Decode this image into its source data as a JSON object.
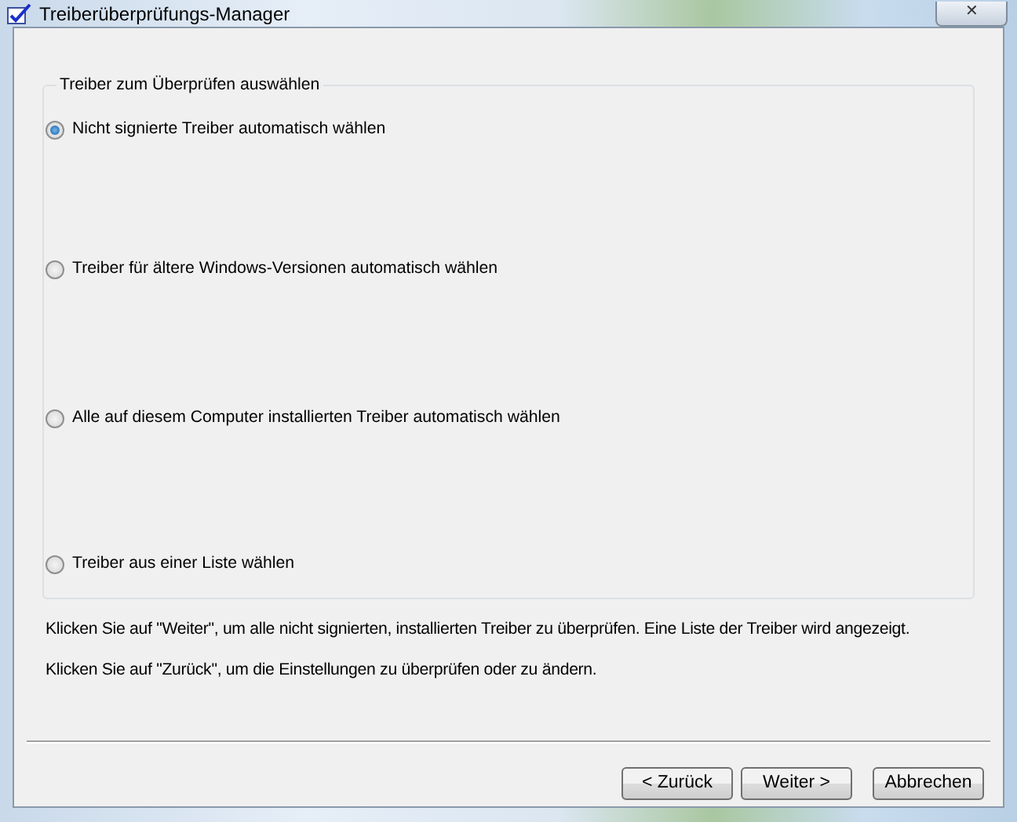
{
  "window": {
    "title": "Treiberüberprüfungs-Manager",
    "close": "✕"
  },
  "group": {
    "title": "Treiber zum Überprüfen auswählen",
    "options": [
      {
        "label": "Nicht signierte Treiber automatisch wählen",
        "selected": true
      },
      {
        "label": "Treiber für ältere Windows-Versionen automatisch wählen",
        "selected": false
      },
      {
        "label": "Alle auf diesem Computer installierten Treiber automatisch wählen",
        "selected": false
      },
      {
        "label": "Treiber aus einer Liste wählen",
        "selected": false
      }
    ]
  },
  "hints": [
    "Klicken Sie auf \"Weiter\", um alle nicht signierten, installierten Treiber zu überprüfen. Eine Liste der Treiber wird angezeigt.",
    "Klicken Sie auf \"Zurück\", um die Einstellungen zu überprüfen oder zu ändern."
  ],
  "buttons": [
    "< Zurück",
    "Weiter >",
    "Abbrechen"
  ]
}
